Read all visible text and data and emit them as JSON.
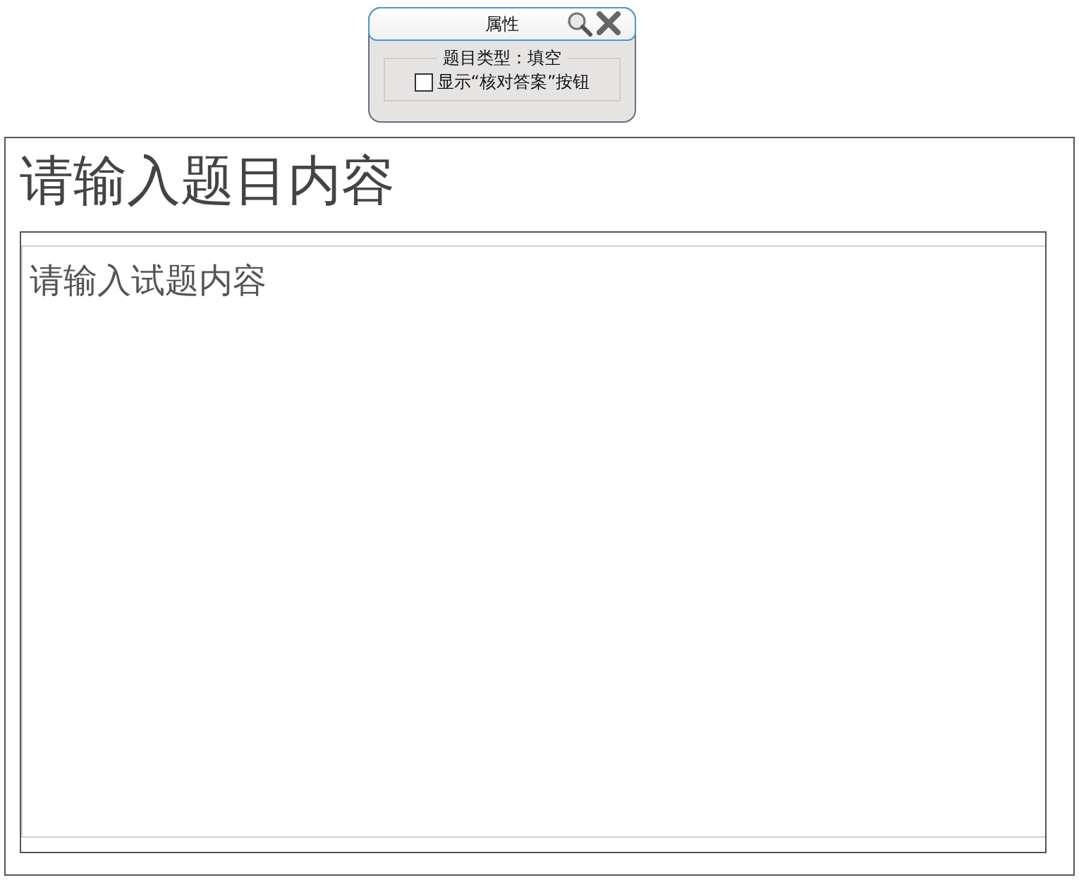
{
  "properties_panel": {
    "title": "属性",
    "group_label": "题目类型：填空",
    "option": {
      "label": "显示“核对答案”按钮",
      "checked": false
    }
  },
  "question": {
    "title": "请输入题目内容",
    "content": {
      "placeholder": "请输入试题内容"
    }
  }
}
